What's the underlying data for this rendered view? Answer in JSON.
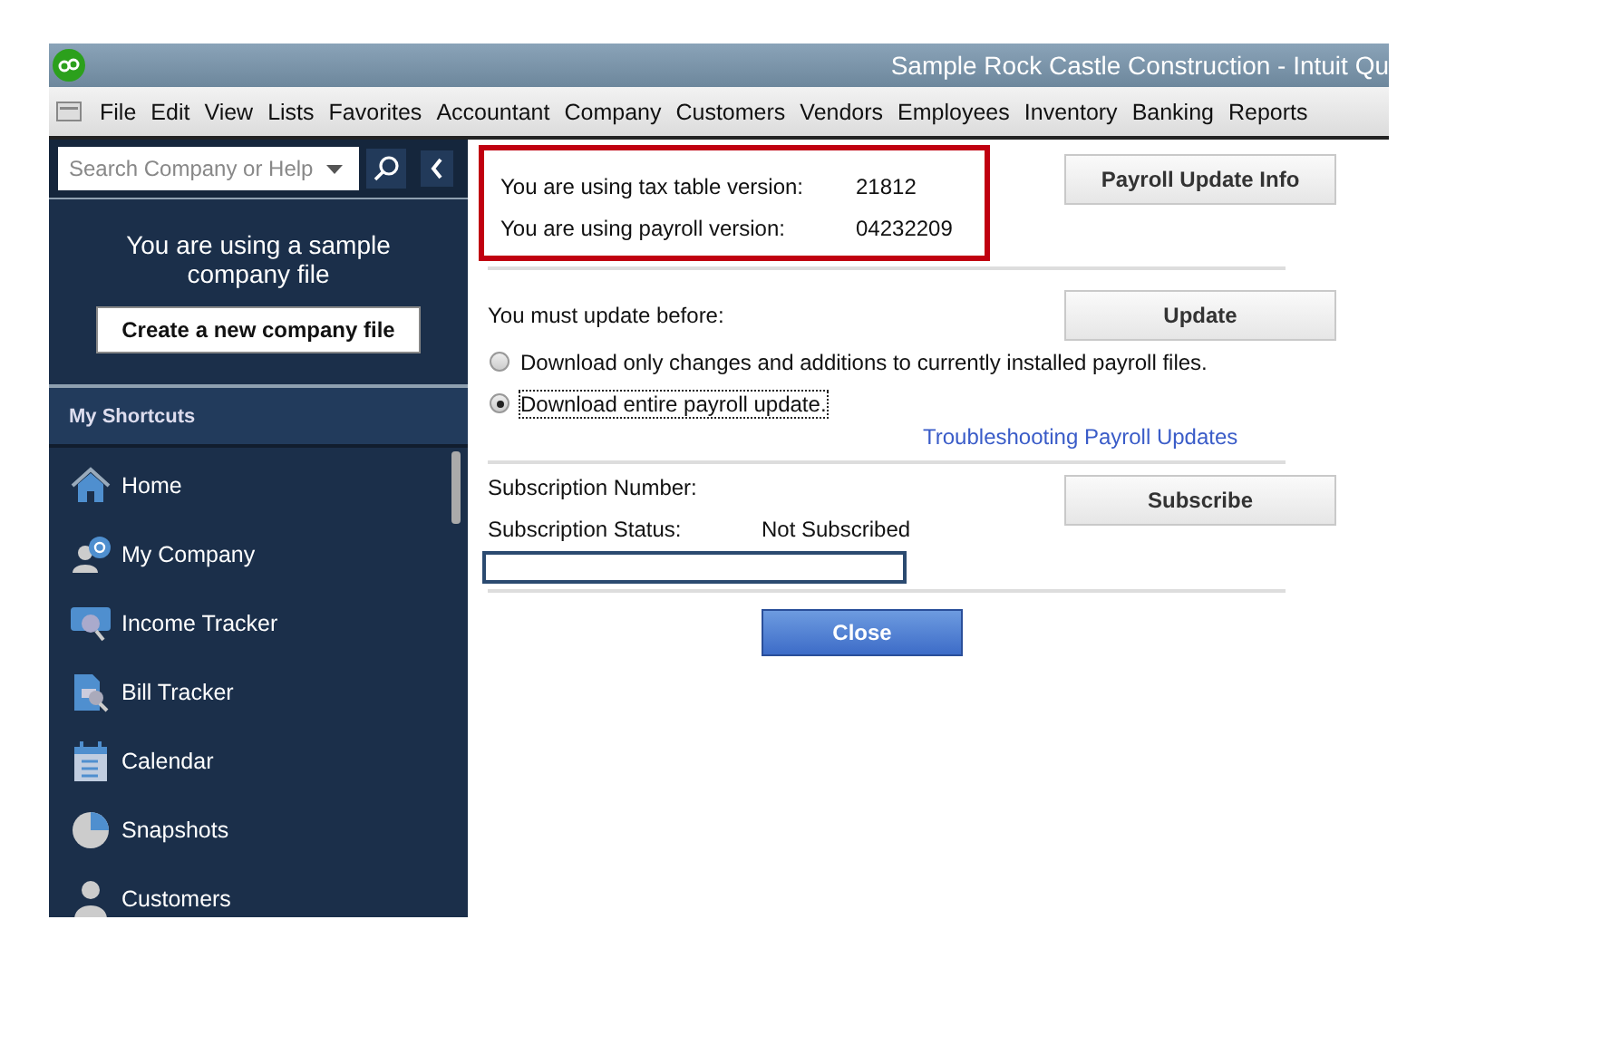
{
  "window": {
    "title": "Sample Rock Castle Construction  - Intuit Qu"
  },
  "menu": [
    "File",
    "Edit",
    "View",
    "Lists",
    "Favorites",
    "Accountant",
    "Company",
    "Customers",
    "Vendors",
    "Employees",
    "Inventory",
    "Banking",
    "Reports"
  ],
  "sidebar": {
    "search": {
      "placeholder": "Search Company or Help"
    },
    "notice": "You are using a sample company file",
    "create_button": "Create a new company file",
    "section_title": "My Shortcuts",
    "items": [
      {
        "label": "Home",
        "kind": "home"
      },
      {
        "label": "My Company",
        "kind": "company"
      },
      {
        "label": "Income Tracker",
        "kind": "income"
      },
      {
        "label": "Bill Tracker",
        "kind": "bill"
      },
      {
        "label": "Calendar",
        "kind": "calendar"
      },
      {
        "label": "Snapshots",
        "kind": "pie"
      },
      {
        "label": "Customers",
        "kind": "person"
      }
    ]
  },
  "dialog": {
    "versions": [
      {
        "label": "You are using tax table version:",
        "value": "21812"
      },
      {
        "label": "You are using payroll version:",
        "value": "04232209"
      }
    ],
    "info_button": "Payroll Update Info",
    "update_label": "You must update before:",
    "update_button": "Update",
    "options": [
      {
        "label": "Download only changes and additions to currently installed payroll files.",
        "selected": false
      },
      {
        "label": "Download entire payroll update.",
        "selected": true
      }
    ],
    "troubleshoot_link": "Troubleshooting Payroll Updates",
    "subscription_number_label": "Subscription Number:",
    "subscription_status_label": "Subscription Status:",
    "subscription_status": "Not Subscribed",
    "subscribe_button": "Subscribe",
    "close_button": "Close"
  }
}
